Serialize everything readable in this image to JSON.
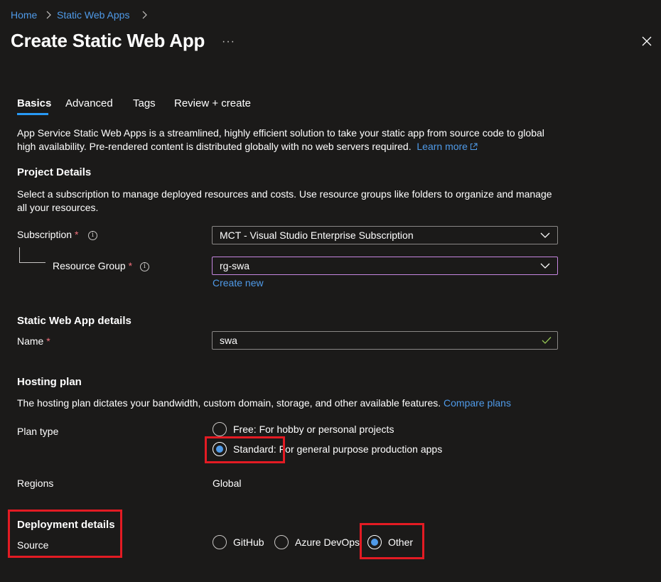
{
  "breadcrumb": {
    "home": "Home",
    "parent": "Static Web Apps"
  },
  "header": {
    "title": "Create Static Web App",
    "more": "···"
  },
  "tabs": [
    {
      "label": "Basics",
      "active": true
    },
    {
      "label": "Advanced"
    },
    {
      "label": "Tags"
    },
    {
      "label": "Review + create"
    }
  ],
  "intro": {
    "line1": "App Service Static Web Apps is a streamlined, highly efficient solution to take your static app from source code to global",
    "line2": "high availability. Pre-rendered content is distributed globally with no web servers required.",
    "learn_more": "Learn more"
  },
  "project_details": {
    "heading": "Project Details",
    "line1": "Select a subscription to manage deployed resources and costs. Use resource groups like folders to organize and manage",
    "line2": "all your resources.",
    "subscription_label": "Subscription",
    "subscription_value": "MCT - Visual Studio Enterprise Subscription",
    "resource_group_label": "Resource Group",
    "resource_group_value": "rg-swa",
    "create_new": "Create new",
    "required_mark": "*",
    "info_glyph": "i"
  },
  "app_details": {
    "heading": "Static Web App details",
    "name_label": "Name",
    "name_value": "swa"
  },
  "hosting": {
    "heading": "Hosting plan",
    "description": "The hosting plan dictates your bandwidth, custom domain, storage, and other available features.",
    "compare_plans": "Compare plans",
    "plan_type_label": "Plan type",
    "free_option": "Free: For hobby or personal projects",
    "standard_option": "Standard: For general purpose production apps",
    "selected": "Standard",
    "regions_label": "Regions",
    "regions_value": "Global"
  },
  "deployment": {
    "heading": "Deployment details",
    "source_label": "Source",
    "options": [
      "GitHub",
      "Azure DevOps",
      "Other"
    ],
    "selected": "Other"
  },
  "colors": {
    "background": "#1b1a19",
    "link": "#4f9ae8",
    "tab_underline": "#2899f5",
    "required": "#f1707b",
    "highlight_box": "#e31b23",
    "valid_check": "#92c353",
    "focus_border": "#c586e0"
  }
}
